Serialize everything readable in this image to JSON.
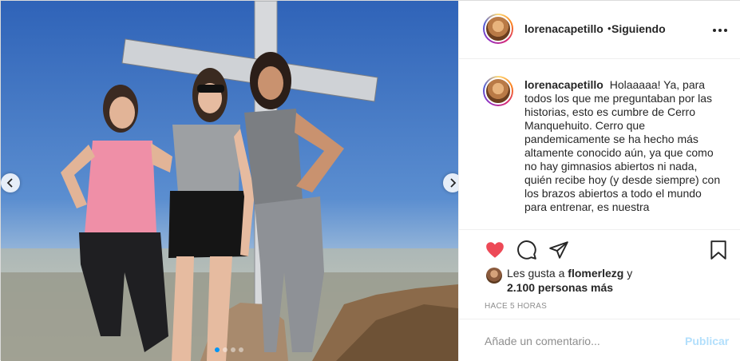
{
  "photo": {
    "alt": "",
    "slide_count": 4,
    "active_slide": 1,
    "colors": {
      "sky": "#3a6fc0",
      "accent": "#0095f6"
    }
  },
  "header": {
    "username": "lorenacapetillo",
    "separator": "•",
    "follow_status": "Siguiendo",
    "more_icon": "more-horizontal-icon"
  },
  "caption": {
    "username": "lorenacapetillo",
    "text": "Holaaaaa! Ya, para todos los que me preguntaban por las historias, esto es cumbre de Cerro Manquehuito. Cerro que pandemicamente se ha hecho más altamente conocido aún, ya que como no hay gimnasios abiertos ni nada, quién recibe hoy (y desde siempre) con los brazos abiertos a todo el mundo para entrenar, es nuestra"
  },
  "actions": {
    "icons": [
      "heart-icon",
      "comment-icon",
      "share-icon",
      "bookmark-icon"
    ],
    "liked": true,
    "like_color": "#ed4956"
  },
  "likes": {
    "prefix": "Les gusta a",
    "user": "flomerlezg",
    "conjunction": "y",
    "others": "2.100 personas más"
  },
  "timestamp": "Hace 5 horas",
  "comment": {
    "placeholder": "Añade un comentario...",
    "publish_label": "Publicar",
    "publish_color": "#b2dffc"
  }
}
